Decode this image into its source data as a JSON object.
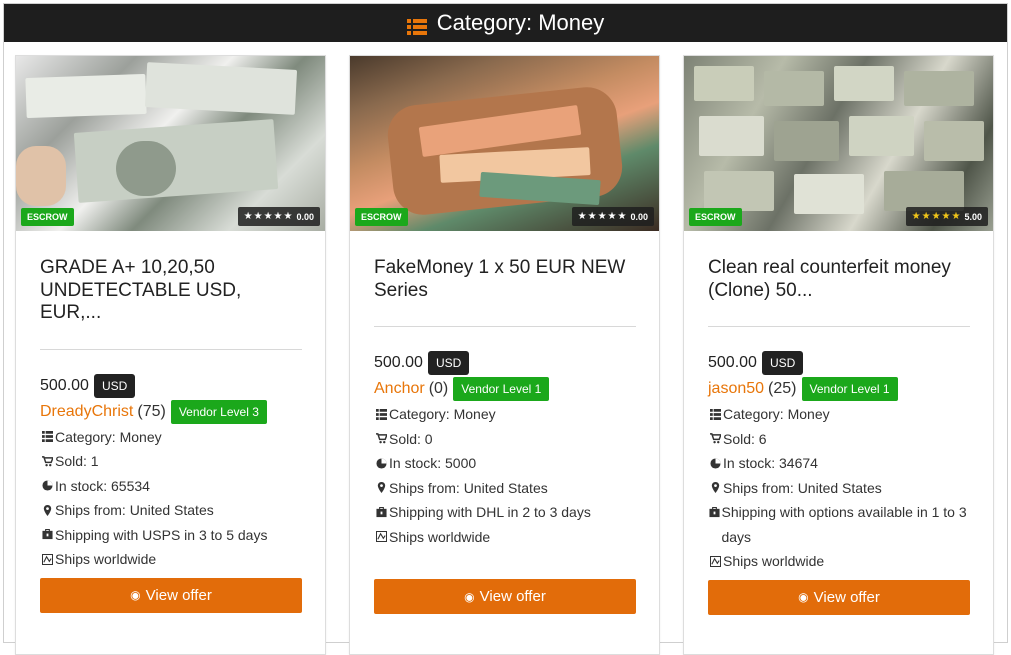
{
  "header": {
    "icon": "list-icon",
    "icon_color": "#e8760a",
    "title": "Category: Money"
  },
  "colors": {
    "accent_orange": "#e26c0a",
    "vendor_link": "#e8760a",
    "badge_green": "#1ba81b",
    "header_bg": "#1e1e1e"
  },
  "cards": [
    {
      "image_alt": "Stack of 100 dollar bills",
      "escrow": "ESCROW",
      "stars": "★★★★★",
      "star_color": "white",
      "rating": "0.00",
      "title": "GRADE A+ 10,20,50 UNDETECTABLE USD, EUR,...",
      "price": "500.00",
      "currency": "USD",
      "vendor": "DreadyChrist",
      "vendor_count": "(75)",
      "vendor_level": "Vendor Level 3",
      "category": "Category: Money",
      "sold": "Sold: 1",
      "stock": "In stock: 65534",
      "ships_from": "Ships from: United States",
      "shipping": "Shipping with USPS in 3 to 5 days",
      "worldwide": "Ships worldwide",
      "button": "View offer"
    },
    {
      "image_alt": "Bag of banknotes",
      "escrow": "ESCROW",
      "stars": "★★★★★",
      "star_color": "white",
      "rating": "0.00",
      "title": "FakeMoney 1 x 50 EUR NEW Series",
      "price": "500.00",
      "currency": "USD",
      "vendor": "Anchor",
      "vendor_count": "(0)",
      "vendor_level": "Vendor Level 1",
      "category": "Category: Money",
      "sold": "Sold: 0",
      "stock": "In stock: 5000",
      "ships_from": "Ships from: United States",
      "shipping": "Shipping with DHL in 2 to 3 days",
      "worldwide": "Ships worldwide",
      "button": "View offer"
    },
    {
      "image_alt": "Many stacks of dollar bills",
      "escrow": "ESCROW",
      "stars": "★★★★★",
      "star_color": "gold",
      "rating": "5.00",
      "title": "Clean real counterfeit money (Clone) 50...",
      "price": "500.00",
      "currency": "USD",
      "vendor": "jason50",
      "vendor_count": "(25)",
      "vendor_level": "Vendor Level 1",
      "category": "Category: Money",
      "sold": "Sold: 6",
      "stock": "In stock: 34674",
      "ships_from": "Ships from: United States",
      "shipping": "Shipping with options available in 1 to 3 days",
      "worldwide": "Ships worldwide",
      "button": "View offer"
    }
  ]
}
